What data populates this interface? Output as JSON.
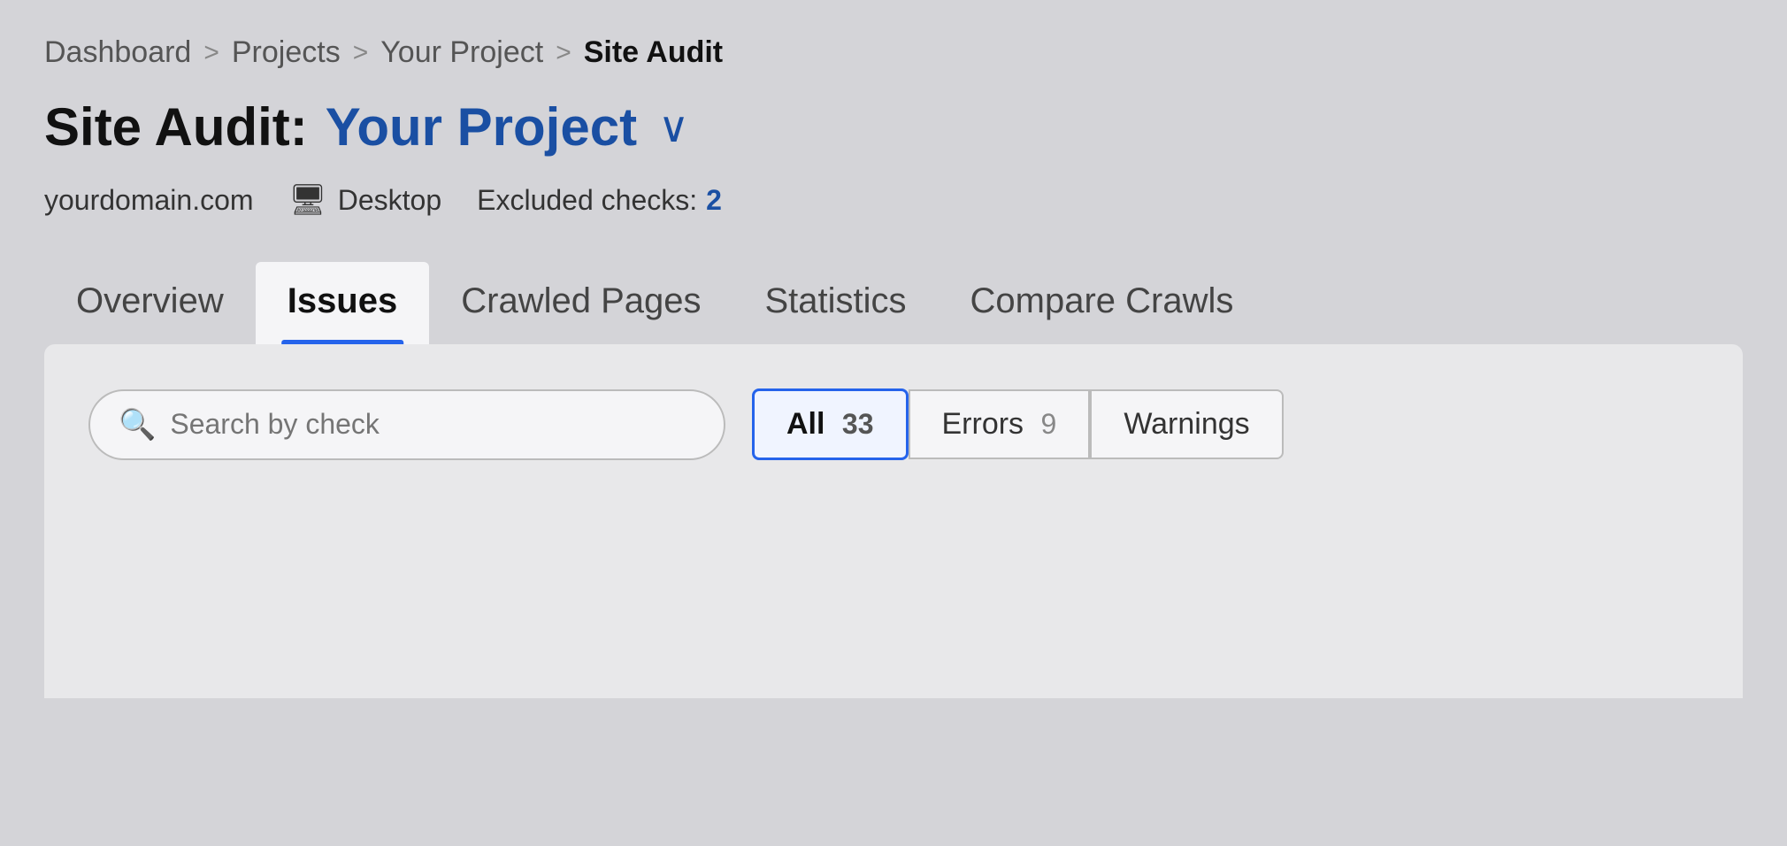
{
  "breadcrumb": {
    "items": [
      {
        "label": "Dashboard",
        "current": false
      },
      {
        "label": "Projects",
        "current": false
      },
      {
        "label": "Your Project",
        "current": false
      },
      {
        "label": "Site Audit",
        "current": true
      }
    ],
    "separator": ">"
  },
  "page": {
    "title_static": "Site Audit:",
    "title_project": "Your Project",
    "chevron": "∨"
  },
  "meta": {
    "domain": "yourdomain.com",
    "device_icon": "🖥",
    "device_label": "Desktop",
    "excluded_label": "Excluded checks:",
    "excluded_count": "2"
  },
  "tabs": [
    {
      "id": "overview",
      "label": "Overview",
      "active": false
    },
    {
      "id": "issues",
      "label": "Issues",
      "active": true
    },
    {
      "id": "crawled-pages",
      "label": "Crawled Pages",
      "active": false
    },
    {
      "id": "statistics",
      "label": "Statistics",
      "active": false
    },
    {
      "id": "compare-crawls",
      "label": "Compare Crawls",
      "active": false
    }
  ],
  "filters": {
    "search_placeholder": "Search by check",
    "buttons": [
      {
        "id": "all",
        "label": "All",
        "count": "33",
        "active": true
      },
      {
        "id": "errors",
        "label": "Errors",
        "count": "9",
        "active": false
      },
      {
        "id": "warnings",
        "label": "Warnings",
        "count": "",
        "active": false
      }
    ]
  }
}
